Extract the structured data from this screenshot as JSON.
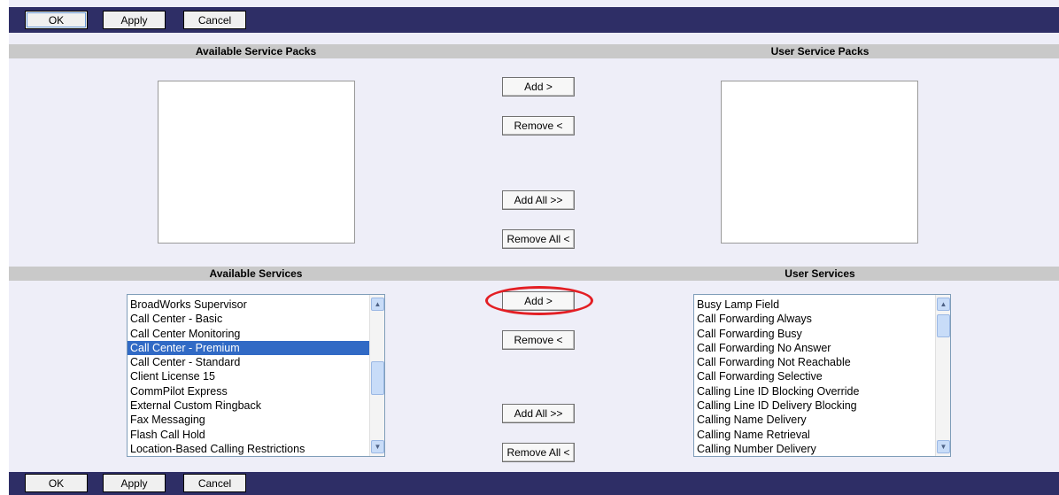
{
  "toolbar": {
    "ok": "OK",
    "apply": "Apply",
    "cancel": "Cancel"
  },
  "service_packs": {
    "available_header": "Available Service Packs",
    "user_header": "User Service Packs",
    "add": "Add >",
    "remove": "Remove <",
    "add_all": "Add All >>",
    "remove_all": "Remove All <"
  },
  "services": {
    "available_header": "Available Services",
    "user_header": "User Services",
    "add": "Add >",
    "remove": "Remove <",
    "add_all": "Add All >>",
    "remove_all": "Remove All <",
    "available_items": [
      "BroadWorks Supervisor",
      "Call Center - Basic",
      "Call Center Monitoring",
      "Call Center - Premium",
      "Call Center - Standard",
      "Client License 15",
      "CommPilot Express",
      "External Custom Ringback",
      "Fax Messaging",
      "Flash Call Hold",
      "Location-Based Calling Restrictions"
    ],
    "selected_available": "Call Center - Premium",
    "user_items": [
      "Busy Lamp Field",
      "Call Forwarding Always",
      "Call Forwarding Busy",
      "Call Forwarding No Answer",
      "Call Forwarding Not Reachable",
      "Call Forwarding Selective",
      "Calling Line ID Blocking Override",
      "Calling Line ID Delivery Blocking",
      "Calling Name Delivery",
      "Calling Name Retrieval",
      "Calling Number Delivery"
    ]
  },
  "colors": {
    "toolbar": "#2e2e66",
    "panel": "#eeeef8",
    "section_header": "#c9c9c9",
    "selection": "#316ac5",
    "annotation": "#e31e24"
  },
  "icons": {
    "scroll_up": "chevron-up-icon",
    "scroll_down": "chevron-down-icon"
  }
}
